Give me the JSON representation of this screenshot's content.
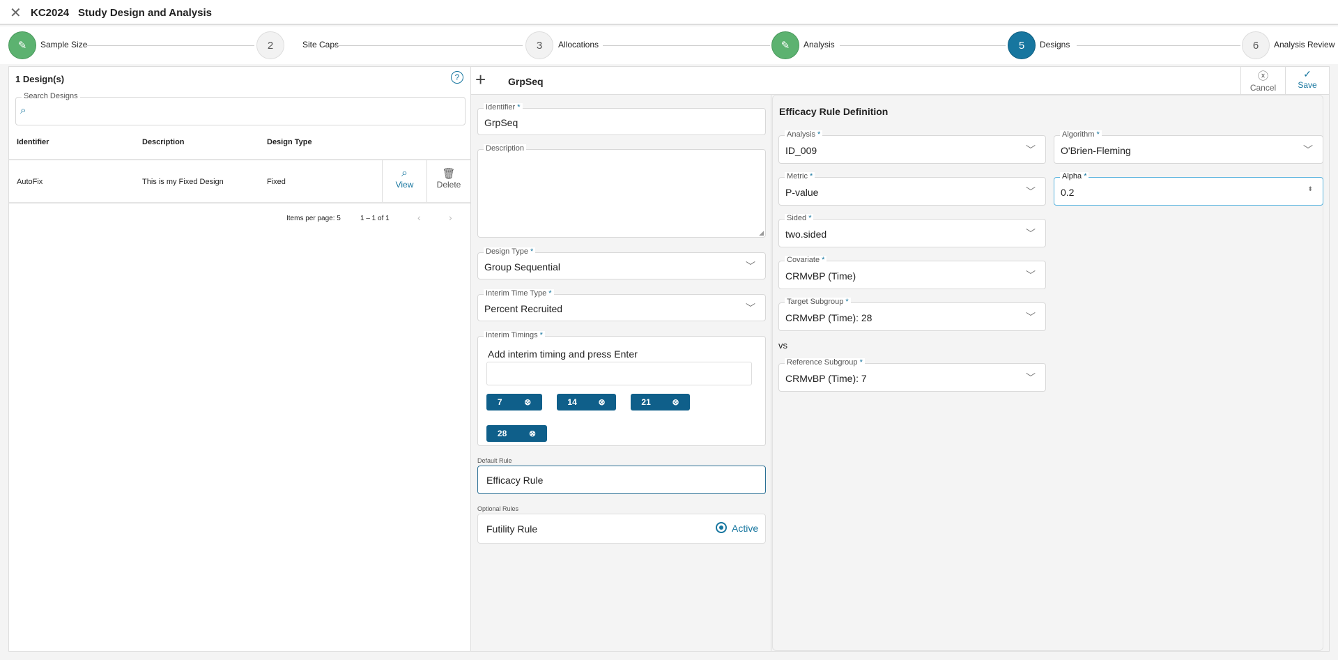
{
  "titlebar": {
    "code": "KC2024",
    "title": "Study Design and Analysis"
  },
  "stepper": [
    {
      "label": "Sample Size",
      "num": "",
      "state": "done"
    },
    {
      "label": "Site Caps",
      "num": "2",
      "state": "pending"
    },
    {
      "label": "Allocations",
      "num": "3",
      "state": "pending"
    },
    {
      "label": "Analysis",
      "num": "",
      "state": "done"
    },
    {
      "label": "Designs",
      "num": "5",
      "state": "active"
    },
    {
      "label": "Analysis Review",
      "num": "6",
      "state": "pending"
    }
  ],
  "left": {
    "count": "1 Design(s)",
    "search_label": "Search Designs",
    "search_value": "",
    "columns": [
      "Identifier",
      "Description",
      "Design Type"
    ],
    "rows": [
      {
        "identifier": "AutoFix",
        "description": "This is my Fixed Design",
        "type": "Fixed",
        "view": "View",
        "delete": "Delete"
      }
    ],
    "pagination": {
      "items_per_page": "Items per page: 5",
      "range": "1 – 1 of 1"
    }
  },
  "editor": {
    "name": "GrpSeq",
    "cancel": "Cancel",
    "save": "Save",
    "identifier": {
      "label": "Identifier",
      "value": "GrpSeq"
    },
    "description": {
      "label": "Description",
      "value": ""
    },
    "design_type": {
      "label": "Design Type",
      "value": "Group Sequential"
    },
    "interim_time_type": {
      "label": "Interim Time Type",
      "value": "Percent Recruited"
    },
    "interim_timings": {
      "label": "Interim Timings",
      "prompt": "Add interim timing and press Enter",
      "chips": [
        "7",
        "14",
        "21",
        "28"
      ]
    },
    "default_rule": {
      "label": "Default Rule",
      "value": "Efficacy Rule"
    },
    "optional_rules": {
      "label": "Optional Rules",
      "rule": "Futility Rule",
      "status": "Active"
    }
  },
  "rule": {
    "title": "Efficacy Rule Definition",
    "analysis": {
      "label": "Analysis",
      "value": "ID_009"
    },
    "algorithm": {
      "label": "Algorithm",
      "value": "O'Brien-Fleming"
    },
    "metric": {
      "label": "Metric",
      "value": "P-value"
    },
    "alpha": {
      "label": "Alpha",
      "value": "0.2"
    },
    "sided": {
      "label": "Sided",
      "value": "two.sided"
    },
    "covariate": {
      "label": "Covariate",
      "value": "CRMvBP (Time)"
    },
    "target": {
      "label": "Target Subgroup",
      "value": "CRMvBP (Time): 28"
    },
    "vs": "vs",
    "reference": {
      "label": "Reference Subgroup",
      "value": "CRMvBP (Time): 7"
    }
  },
  "colors": {
    "accent": "#17769f",
    "done": "#5cb270",
    "chip": "#0f5f8a"
  }
}
